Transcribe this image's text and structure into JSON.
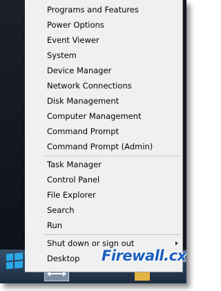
{
  "menu": {
    "group1": [
      {
        "id": "programs-features",
        "label": "Programs and Features"
      },
      {
        "id": "power-options",
        "label": "Power Options"
      },
      {
        "id": "event-viewer",
        "label": "Event Viewer"
      },
      {
        "id": "system",
        "label": "System"
      },
      {
        "id": "device-manager",
        "label": "Device Manager"
      },
      {
        "id": "network-connections",
        "label": "Network Connections"
      },
      {
        "id": "disk-management",
        "label": "Disk Management"
      },
      {
        "id": "computer-management",
        "label": "Computer Management"
      },
      {
        "id": "command-prompt",
        "label": "Command Prompt"
      },
      {
        "id": "command-prompt-admin",
        "label": "Command Prompt (Admin)"
      }
    ],
    "group2": [
      {
        "id": "task-manager",
        "label": "Task Manager"
      },
      {
        "id": "control-panel",
        "label": "Control Panel"
      },
      {
        "id": "file-explorer",
        "label": "File Explorer"
      },
      {
        "id": "search",
        "label": "Search"
      },
      {
        "id": "run",
        "label": "Run"
      }
    ],
    "group3": [
      {
        "id": "shut-down",
        "label": "Shut down or sign out",
        "submenu": true
      },
      {
        "id": "desktop",
        "label": "Desktop"
      }
    ]
  },
  "watermark": {
    "text": "Firewall.cx"
  },
  "colors": {
    "menu_bg": "#f0f0f0",
    "taskbar": "#2a3f57",
    "windows_logo": "#2aa7e6",
    "watermark": "#1b5fbf"
  },
  "icons": {
    "start": "windows-logo-icon",
    "submenu": "chevron-right-icon"
  }
}
